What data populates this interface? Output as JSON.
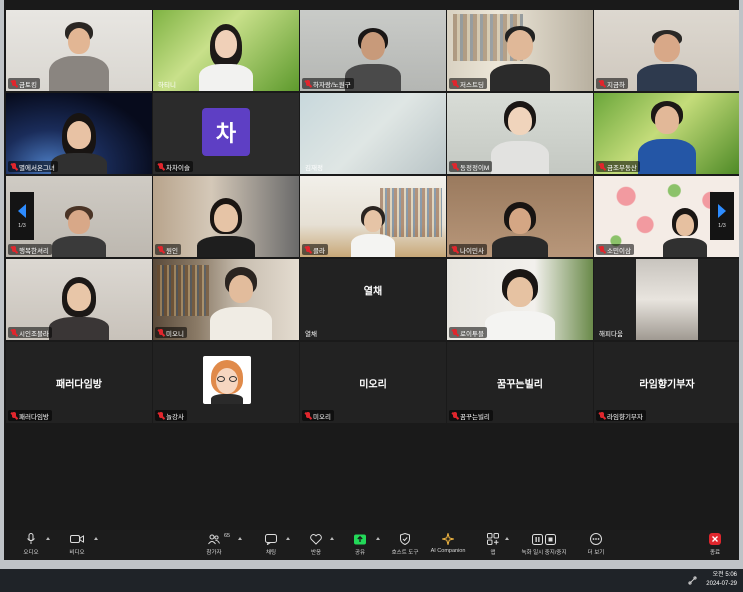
{
  "gallery": {
    "tiles": [
      {
        "name": "금토킹",
        "muted": true
      },
      {
        "name": "하티니",
        "muted": false
      },
      {
        "name": "하자랑/노원구",
        "muted": true
      },
      {
        "name": "저스트딩",
        "muted": true
      },
      {
        "name": "지금하",
        "muted": true
      },
      {
        "name": "별에서온그녀",
        "muted": true
      },
      {
        "name": "차차이슬",
        "muted": true,
        "avatar_letter": "차"
      },
      {
        "name": "김재정",
        "muted": false
      },
      {
        "name": "동정정이M",
        "muted": true
      },
      {
        "name": "금조부동산",
        "muted": true
      },
      {
        "name": "행복한셔리",
        "muted": true
      },
      {
        "name": "원인",
        "muted": true
      },
      {
        "name": "클라",
        "muted": true
      },
      {
        "name": "나이민사",
        "muted": true
      },
      {
        "name": "소민이삼",
        "muted": true
      },
      {
        "name": "시인조블라",
        "muted": true
      },
      {
        "name": "미오니",
        "muted": true
      },
      {
        "name": "열채",
        "muted": false,
        "display_name": "열채"
      },
      {
        "name": "로이투블",
        "muted": true
      },
      {
        "name": "해피다움",
        "muted": false
      },
      {
        "name": "패러다임방",
        "muted": true,
        "display_name": "패러다임방"
      },
      {
        "name": "놀강사",
        "muted": true
      },
      {
        "name": "미오리",
        "muted": true,
        "display_name": "미오리"
      },
      {
        "name": "꿈꾸는빌리",
        "muted": true,
        "display_name": "꿈꾸는빌리"
      },
      {
        "name": "라임향기부자",
        "muted": true,
        "display_name": "라임향기부자"
      }
    ],
    "page_left": "1/3",
    "page_right": "1/3"
  },
  "toolbar": {
    "audio": "오디오",
    "video": "비디오",
    "participants": "참가자",
    "participants_count": "65",
    "chat": "채팅",
    "react": "반응",
    "share": "공유",
    "host_tools": "호스트 도구",
    "ai_companion": "AI Companion",
    "apps": "앱",
    "record": "녹화 일시 중지/중지",
    "more": "더 보기",
    "end": "종료"
  },
  "taskbar": {
    "time": "오전 5:06",
    "date": "2024-07-29"
  },
  "colors": {
    "active_speaker": "#23d959",
    "muted": "#e0262d",
    "accent": "#2d8cff",
    "end": "#e0262d",
    "avatar": "#5e3fc4"
  }
}
